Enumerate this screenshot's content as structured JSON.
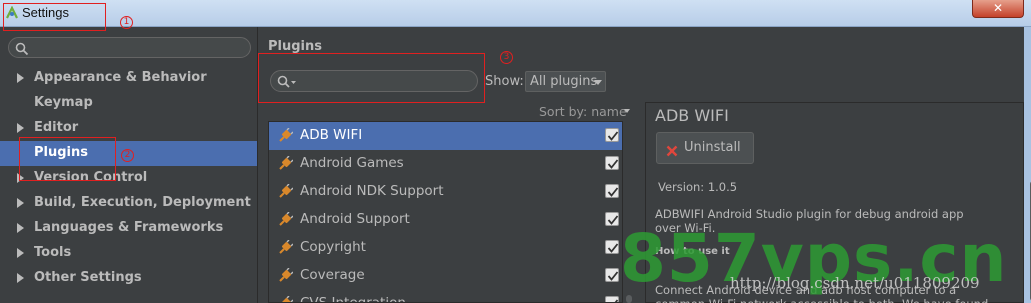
{
  "window": {
    "title": "Settings",
    "close_label": "✕"
  },
  "sidebar": {
    "search_placeholder": "",
    "items": [
      {
        "label": "Appearance & Behavior",
        "expandable": true,
        "selected": false
      },
      {
        "label": "Keymap",
        "expandable": false,
        "selected": false
      },
      {
        "label": "Editor",
        "expandable": true,
        "selected": false
      },
      {
        "label": "Plugins",
        "expandable": false,
        "selected": true
      },
      {
        "label": "Version Control",
        "expandable": true,
        "selected": false
      },
      {
        "label": "Build, Execution, Deployment",
        "expandable": true,
        "selected": false
      },
      {
        "label": "Languages & Frameworks",
        "expandable": true,
        "selected": false
      },
      {
        "label": "Tools",
        "expandable": true,
        "selected": false
      },
      {
        "label": "Other Settings",
        "expandable": true,
        "selected": false
      }
    ]
  },
  "plugins": {
    "title": "Plugins",
    "search_placeholder": "",
    "show_label": "Show:",
    "show_value": "All plugins",
    "sort_label": "Sort by: name",
    "list": [
      {
        "name": "ADB WIFI",
        "checked": true,
        "selected": true
      },
      {
        "name": "Android Games",
        "checked": true,
        "selected": false
      },
      {
        "name": "Android NDK Support",
        "checked": true,
        "selected": false
      },
      {
        "name": "Android Support",
        "checked": true,
        "selected": false
      },
      {
        "name": "Copyright",
        "checked": true,
        "selected": false
      },
      {
        "name": "Coverage",
        "checked": true,
        "selected": false
      },
      {
        "name": "CVS Integration",
        "checked": true,
        "selected": false
      }
    ]
  },
  "detail": {
    "name": "ADB WIFI",
    "uninstall_label": "Uninstall",
    "version": "Version: 1.0.5",
    "description": "ADBWIFI Android Studio plugin for debug android app over Wi-Fi.",
    "how_to_heading": "How to use it",
    "description2": "Connect Android device and adb host computer to a common Wi-Fi network accessible to both. We have found"
  },
  "annotations": {
    "one": "1",
    "two": "2",
    "three": "3"
  },
  "watermark": {
    "text": "857vps.cn",
    "url": "http://blog.csdn.net/u011809209"
  },
  "colors": {
    "selection": "#4b6eaf",
    "background": "#3c3f41",
    "annotation": "#e02020",
    "watermark": "#2d9b33"
  }
}
